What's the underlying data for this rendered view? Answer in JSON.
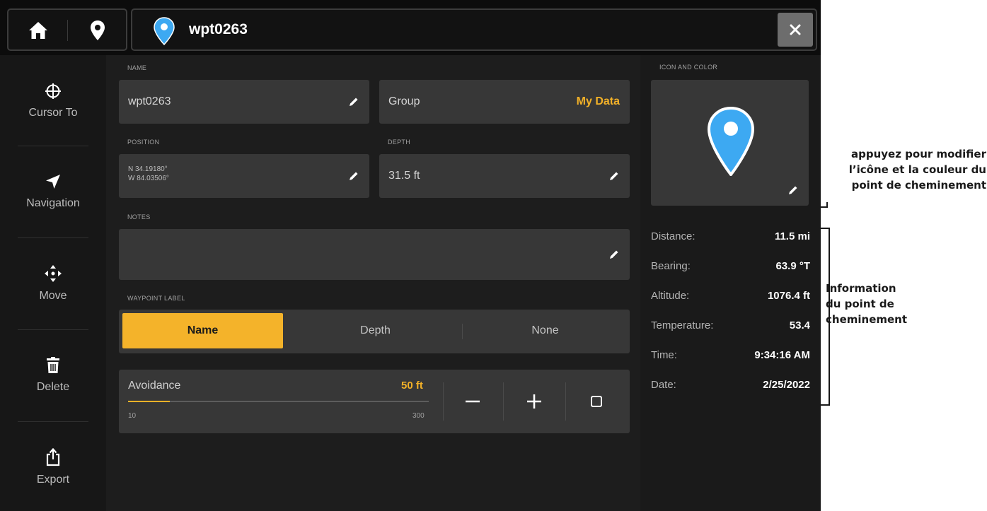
{
  "topbar": {
    "title": "wpt0263",
    "home_icon": "home-icon",
    "pin_icon": "map-pin-icon",
    "close_icon": "close-icon"
  },
  "sidebar": {
    "items": [
      {
        "label": "Cursor To",
        "icon": "crosshair-icon"
      },
      {
        "label": "Navigation",
        "icon": "navigation-arrow-icon"
      },
      {
        "label": "Move",
        "icon": "move-icon"
      },
      {
        "label": "Delete",
        "icon": "trash-icon"
      },
      {
        "label": "Export",
        "icon": "export-icon"
      }
    ]
  },
  "form": {
    "name_label": "NAME",
    "name_value": "wpt0263",
    "group_label": "Group",
    "group_value": "My Data",
    "position_label": "POSITION",
    "position_lat": "N 34.19180°",
    "position_lon": "W 84.03506°",
    "depth_label": "DEPTH",
    "depth_value": "31.5 ft",
    "notes_label": "NOTES",
    "notes_value": "",
    "waypoint_label_label": "WAYPOINT LABEL",
    "waypoint_label_options": [
      "Name",
      "Depth",
      "None"
    ],
    "waypoint_label_selected": "Name",
    "avoidance_label": "Avoidance",
    "avoidance_value": "50 ft",
    "avoidance_min": "10",
    "avoidance_max": "300",
    "avoidance_fraction": 0.138
  },
  "right_panel": {
    "icon_color_label": "ICON AND COLOR",
    "pin_color": "#3da9f2",
    "info": [
      {
        "key": "Distance:",
        "value": "11.5 mi"
      },
      {
        "key": "Bearing:",
        "value": "63.9 °T"
      },
      {
        "key": "Altitude:",
        "value": "1076.4 ft"
      },
      {
        "key": "Temperature:",
        "value": "53.4"
      },
      {
        "key": "Time:",
        "value": "9:34:16 AM"
      },
      {
        "key": "Date:",
        "value": "2/25/2022"
      }
    ]
  },
  "callouts": {
    "icon_edit": [
      "appuyez pour modifier",
      "l’icône et la couleur du",
      "point de cheminement"
    ],
    "info": [
      "Information",
      "du point de",
      "cheminement"
    ]
  },
  "colors": {
    "accent": "#f4b32a",
    "pin": "#3da9f2"
  }
}
